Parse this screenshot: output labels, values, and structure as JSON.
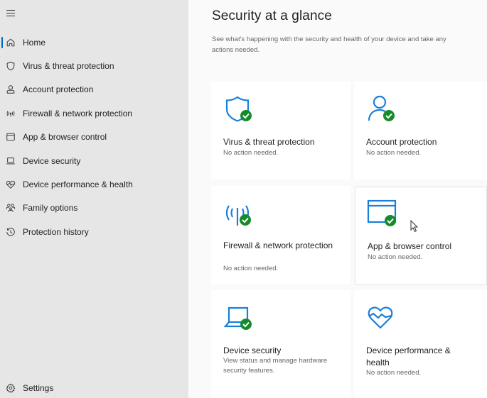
{
  "sidebar": {
    "menu_icon": "hamburger-icon",
    "items": [
      {
        "label": "Home",
        "icon": "home-icon",
        "active": true
      },
      {
        "label": "Virus & threat protection",
        "icon": "shield-icon"
      },
      {
        "label": "Account protection",
        "icon": "person-icon"
      },
      {
        "label": "Firewall & network protection",
        "icon": "antenna-icon"
      },
      {
        "label": "App & browser control",
        "icon": "window-icon"
      },
      {
        "label": "Device security",
        "icon": "laptop-icon"
      },
      {
        "label": "Device performance & health",
        "icon": "heart-pulse-icon"
      },
      {
        "label": "Family options",
        "icon": "family-icon"
      },
      {
        "label": "Protection history",
        "icon": "history-icon"
      }
    ],
    "settings": {
      "label": "Settings",
      "icon": "gear-icon"
    }
  },
  "main": {
    "title": "Security at a glance",
    "subtitle": "See what's happening with the security and health of your device and take any actions needed.",
    "cards": [
      {
        "title": "Virus & threat protection",
        "status": "No action needed.",
        "icon": "shield-icon",
        "ok": true
      },
      {
        "title": "Account protection",
        "status": "No action needed.",
        "icon": "person-icon",
        "ok": true
      },
      {
        "title": "Firewall & network protection",
        "status": "No action needed.",
        "icon": "antenna-icon",
        "ok": true
      },
      {
        "title": "App & browser control",
        "status": "No action needed.",
        "icon": "window-icon",
        "ok": true
      },
      {
        "title": "Device security",
        "status": "View status and manage hardware security features.",
        "icon": "laptop-icon",
        "ok": true
      },
      {
        "title": "Device performance & health",
        "status": "No action needed.",
        "icon": "heart-pulse-icon",
        "ok": false
      }
    ]
  },
  "colors": {
    "accent": "#0067c0",
    "icon_blue": "#1a7fd9",
    "ok_green": "#168b2c",
    "sidebar_bg": "#e6e6e6",
    "content_bg": "#fafafa"
  }
}
